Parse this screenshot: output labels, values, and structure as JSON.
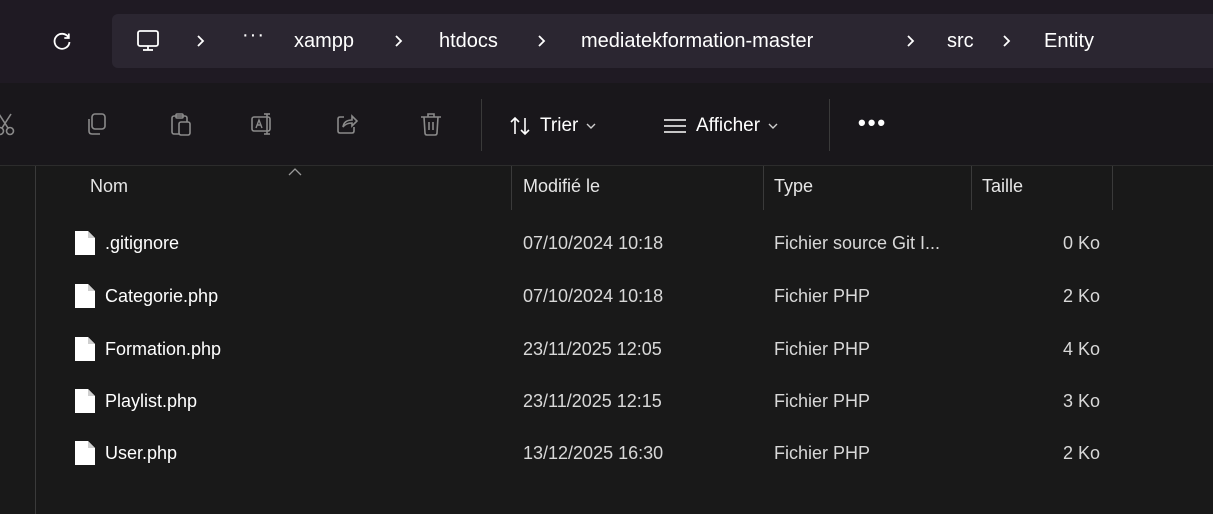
{
  "address_bar": {
    "crumbs": [
      "xampp",
      "htdocs",
      "mediatekformation-master",
      "src",
      "Entity"
    ],
    "overflow_label": "···",
    "icons": {
      "refresh": "refresh-icon",
      "pc": "this-pc-icon",
      "separator": "chevron-right-icon"
    }
  },
  "command_bar": {
    "icons": [
      "cut-icon",
      "copy-icon",
      "paste-icon",
      "rename-icon",
      "share-icon",
      "delete-icon"
    ],
    "sort_label": "Trier",
    "view_label": "Afficher",
    "more_label": "•••"
  },
  "columns": {
    "name": "Nom",
    "modified": "Modifié le",
    "type": "Type",
    "size": "Taille"
  },
  "files": [
    {
      "name": ".gitignore",
      "modified": "07/10/2024 10:18",
      "type": "Fichier source Git I...",
      "size": "0 Ko"
    },
    {
      "name": "Categorie.php",
      "modified": "07/10/2024 10:18",
      "type": "Fichier PHP",
      "size": "2 Ko"
    },
    {
      "name": "Formation.php",
      "modified": "23/11/2025 12:05",
      "type": "Fichier PHP",
      "size": "4 Ko"
    },
    {
      "name": "Playlist.php",
      "modified": "23/11/2025 12:15",
      "type": "Fichier PHP",
      "size": "3 Ko"
    },
    {
      "name": "User.php",
      "modified": "13/12/2025 16:30",
      "type": "Fichier PHP",
      "size": "2 Ko"
    }
  ]
}
